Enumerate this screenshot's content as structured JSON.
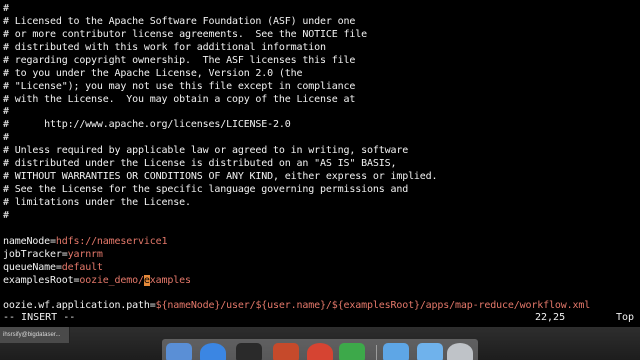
{
  "editor": {
    "lines": [
      {
        "key": "#",
        "val": ""
      },
      {
        "key": "# Licensed to the Apache Software Foundation (ASF) under one",
        "val": ""
      },
      {
        "key": "# or more contributor license agreements.  See the NOTICE file",
        "val": ""
      },
      {
        "key": "# distributed with this work for additional information",
        "val": ""
      },
      {
        "key": "# regarding copyright ownership.  The ASF licenses this file",
        "val": ""
      },
      {
        "key": "# to you under the Apache License, Version 2.0 (the",
        "val": ""
      },
      {
        "key": "# \"License\"); you may not use this file except in compliance",
        "val": ""
      },
      {
        "key": "# with the License.  You may obtain a copy of the License at",
        "val": ""
      },
      {
        "key": "#",
        "val": ""
      },
      {
        "key": "#      http://www.apache.org/licenses/LICENSE-2.0",
        "val": ""
      },
      {
        "key": "#",
        "val": ""
      },
      {
        "key": "# Unless required by applicable law or agreed to in writing, software",
        "val": ""
      },
      {
        "key": "# distributed under the License is distributed on an \"AS IS\" BASIS,",
        "val": ""
      },
      {
        "key": "# WITHOUT WARRANTIES OR CONDITIONS OF ANY KIND, either express or implied.",
        "val": ""
      },
      {
        "key": "# See the License for the specific language governing permissions and",
        "val": ""
      },
      {
        "key": "# limitations under the License.",
        "val": ""
      },
      {
        "key": "#",
        "val": ""
      },
      {
        "key": "",
        "val": ""
      },
      {
        "key": "nameNode=",
        "val": "hdfs://nameservice1"
      },
      {
        "key": "jobTracker=",
        "val": "yarnrm"
      },
      {
        "key": "queueName=",
        "val": "default"
      },
      {
        "key": "examplesRoot=",
        "val": "oozie_demo/",
        "cursor": "e",
        "rest": "xamples"
      },
      {
        "key": "",
        "val": ""
      },
      {
        "key": "oozie.wf.application.path=",
        "val": "${nameNode}/user/${user.name}/${examplesRoot}/apps/map-reduce/workflow.xml"
      }
    ],
    "status": {
      "mode": "-- INSERT --",
      "position": "22,25",
      "scroll": "Top"
    }
  },
  "taskbar": {
    "window_tab": "ihsrsify@bigdataser..."
  },
  "dock": {
    "background": "#c8c8cc",
    "icons": [
      {
        "name": "launchpad-icon",
        "color": "#5a8fd6"
      },
      {
        "name": "safari-icon",
        "color": "#3b86e3"
      },
      {
        "name": "terminal-icon",
        "color": "#2a2a2a"
      },
      {
        "name": "powerpoint-icon",
        "color": "#c64a2b"
      },
      {
        "name": "recording-icon",
        "color": "#d64432"
      },
      {
        "name": "camtasia-icon",
        "color": "#3da94a"
      },
      {
        "name": "finder-folder-icon",
        "color": "#5ea6e6"
      },
      {
        "name": "downloads-folder-icon",
        "color": "#6fb2ec"
      },
      {
        "name": "trash-icon",
        "color": "#bfc3c8"
      }
    ]
  }
}
